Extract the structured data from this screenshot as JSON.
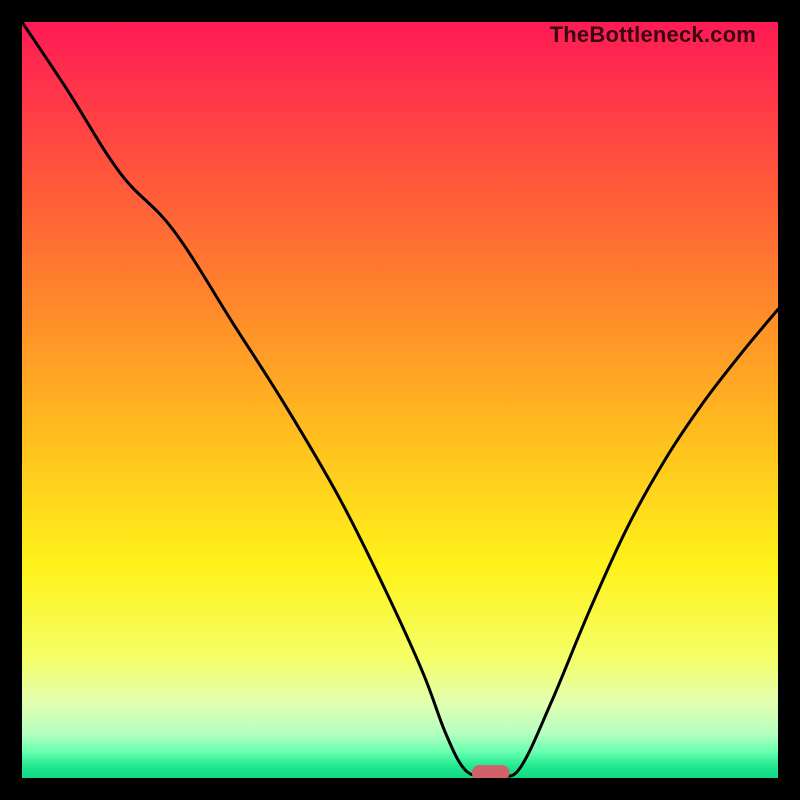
{
  "watermark": "TheBottleneck.com",
  "colors": {
    "frame": "#000000",
    "curve": "#000000",
    "marker": "#d1616a",
    "gradient_stops": [
      {
        "offset": 0.0,
        "color": "#ff1a55"
      },
      {
        "offset": 0.18,
        "color": "#ff4f3e"
      },
      {
        "offset": 0.38,
        "color": "#ff8a2a"
      },
      {
        "offset": 0.55,
        "color": "#ffbf1f"
      },
      {
        "offset": 0.72,
        "color": "#fff21a"
      },
      {
        "offset": 0.84,
        "color": "#f5ff66"
      },
      {
        "offset": 0.9,
        "color": "#e2ffb0"
      },
      {
        "offset": 0.94,
        "color": "#b8ffc0"
      },
      {
        "offset": 0.965,
        "color": "#6affb0"
      },
      {
        "offset": 0.985,
        "color": "#1fe88f"
      },
      {
        "offset": 1.0,
        "color": "#12d882"
      }
    ]
  },
  "chart_data": {
    "type": "line",
    "title": "",
    "xlabel": "",
    "ylabel": "",
    "xlim": [
      0,
      100
    ],
    "ylim": [
      0,
      100
    ],
    "x": [
      0,
      6,
      13,
      20,
      28,
      35,
      42,
      48,
      53,
      56,
      58.5,
      61,
      63.5,
      66,
      70,
      75,
      80,
      85,
      90,
      95,
      100
    ],
    "values": [
      100,
      91,
      80,
      72.5,
      60,
      49,
      37,
      25,
      14,
      6,
      1.2,
      0.2,
      0.2,
      1.5,
      10,
      22,
      33,
      42,
      49.5,
      56,
      62
    ],
    "marker": {
      "x": 62,
      "y": 0.7,
      "width": 5,
      "height": 2,
      "rx": 1
    }
  }
}
